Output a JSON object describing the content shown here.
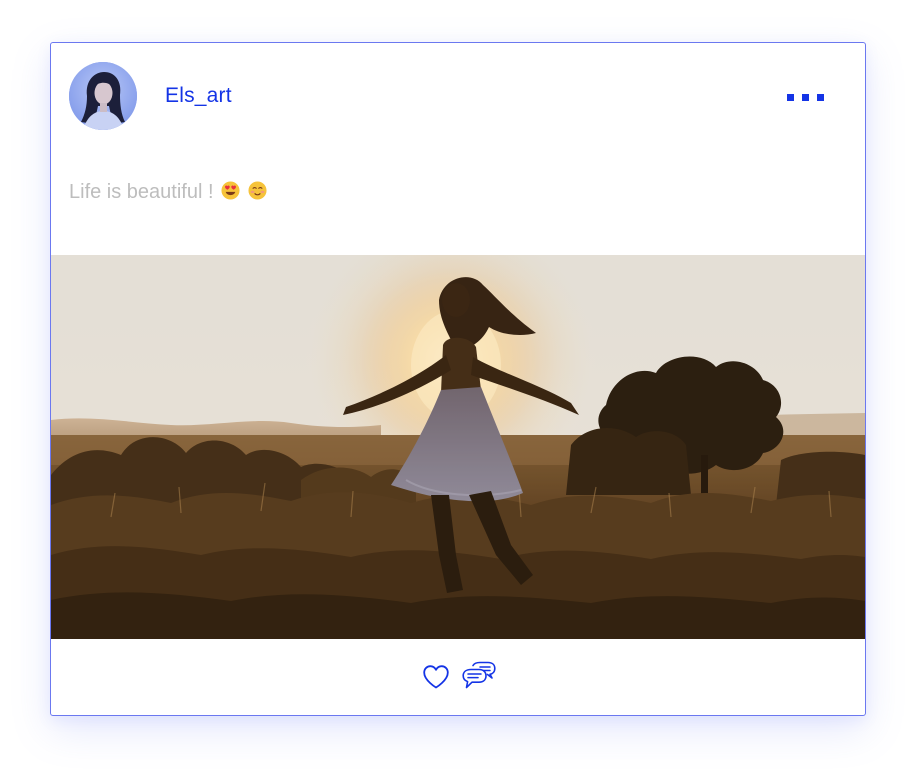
{
  "post": {
    "author": {
      "username": "Els_art",
      "avatar_icon": "user-avatar"
    },
    "menu_icon": "more-options-icon",
    "caption": {
      "text": "Life is beautiful !",
      "emojis": [
        "heart-eyes-emoji",
        "blushing-smile-emoji"
      ]
    },
    "image_icon": "post-photo",
    "actions": {
      "like_icon": "heart-icon",
      "comment_icon": "comment-bubbles-icon"
    }
  },
  "colors": {
    "accent": "#1434e6",
    "card_border": "#6b78f0",
    "caption_text": "#bdbdbd",
    "shadow": "#6e7df5"
  }
}
